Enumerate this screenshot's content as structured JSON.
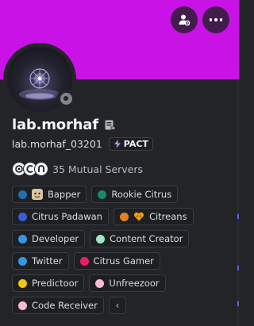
{
  "colors": {
    "banner": "#c913e6",
    "card": "#232428",
    "status_offline": "#80848e"
  },
  "header": {
    "profile_button_icon": "user-settings-icon",
    "more_button_icon": "more-dots-icon"
  },
  "profile": {
    "display_name": "lab.morhaf",
    "username": "lab.morhaf_03201",
    "tag": {
      "icon": "lightning-icon",
      "label": "PACT"
    },
    "note_icon": "note-icon",
    "status": "offline"
  },
  "mutual": {
    "text": "35 Mutual Servers",
    "icons": [
      "server-icon-1",
      "server-icon-2",
      "server-icon-3"
    ]
  },
  "roles": [
    {
      "label": "Bapper",
      "color": "#1f6fb2",
      "emoji": "face"
    },
    {
      "label": "Rookie Citrus",
      "color": "#1a8a6e"
    },
    {
      "label": "Citrus Padawan",
      "color": "#3b5dd6"
    },
    {
      "label": "Citreans",
      "color": "#e67e22",
      "emoji": "heart"
    },
    {
      "label": "Developer",
      "color": "#3498db"
    },
    {
      "label": "Content Creator",
      "color": "#a3e4c6"
    },
    {
      "label": "Twitter",
      "color": "#3498db"
    },
    {
      "label": "Citrus Gamer",
      "color": "#e91e63"
    },
    {
      "label": "Predictoor",
      "color": "#f1c40f"
    },
    {
      "label": "Unfreezoor",
      "color": "#f8bbd0"
    },
    {
      "label": "Code Receiver",
      "color": "#f8bbd0"
    }
  ],
  "collapse_glyph": "‹"
}
